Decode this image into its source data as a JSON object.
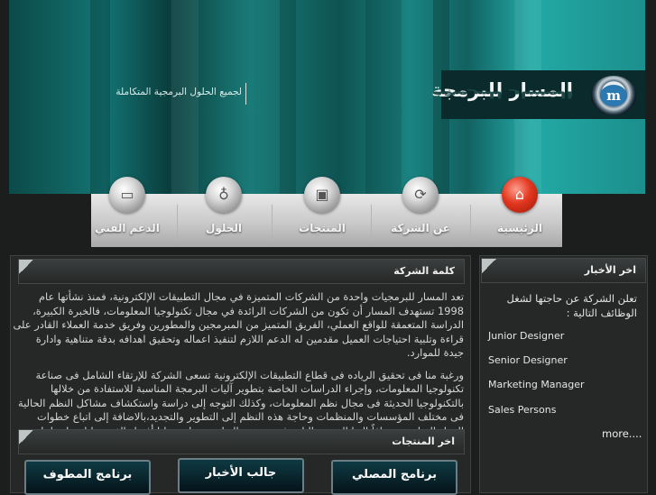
{
  "brand": {
    "logo_text": "المسار للبرمجة",
    "tagline": "لجميع الحلول البرمجية المتكاملة",
    "emblem_letter": "m",
    "accent": "#1b8f8c"
  },
  "nav": {
    "items": [
      {
        "label": "الرئيسية",
        "icon": "home-icon"
      },
      {
        "label": "عن الشركة",
        "icon": "info-icon"
      },
      {
        "label": "المنتجات",
        "icon": "box-icon"
      },
      {
        "label": "الحلول",
        "icon": "bag-icon"
      },
      {
        "label": "الدعم الفني",
        "icon": "chat-icon"
      }
    ]
  },
  "about": {
    "heading": "كلمة الشركة",
    "paragraph1": "تعد المسار للبرمجيات واحدة من الشركات المتميزة في مجال التطبيقات الإلكترونية، فمنذ نشأتها عام 1998 تستهدف المسار أن تكون من الشركات الرائدة في مجال تكنولوجيا المعلومات، فالخبرة الكبيرة، الدراسة المتعمقة للواقع العملي، الفريق المتميز من المبرمجين والمطورين وفريق خدمة العملاء القادر على قراءة وتلبية احتياجات العميل مقدمين له الدعم اللازم لتنفيذ اعماله وتحقيق اهدافه بدقة متناهية وادارة جيدة للموارد.",
    "paragraph2": "ورغبة منا فى تحقيق الرياده فى قطاع التطبيقات الإلكترونية تسعى الشركة للإرتقاء الشامل فى صناعة تكنولوجيا المعلومات، وإجراء الدراسات الخاصة بتطوير آليات البرمجة المناسبة للاستفادة من خلالها بالتكنولوجيا الحديثة فى مجال نظم المعلومات، وكذلك التوجه إلى دراسة واستكشاف مشاكل النظم الحالية فى مختلف المؤسسات والمنظمات وحاجة هذه النظم إلى التطوير والتجديد،بالاضافة إلى اتباع خطوات العمل المناسبة مضافاً إليها المرونة التامة فى منهجية التطبيق مما يتيح لنا أفضل الفرص لتلبية احتياجات العملاء."
  },
  "products": {
    "heading": "اخر المنتجات",
    "items": [
      "برنامج المصلي",
      "جالب الأخبار",
      "برنامج المطوف"
    ]
  },
  "news": {
    "heading": "اخر الأخبار",
    "intro": "تعلن الشركة عن حاجتها لشغل الوظائف التالية :",
    "jobs": [
      "Junior Designer",
      "Senior Designer",
      "Marketing Manager",
      "Sales Persons"
    ],
    "more": "more...."
  }
}
